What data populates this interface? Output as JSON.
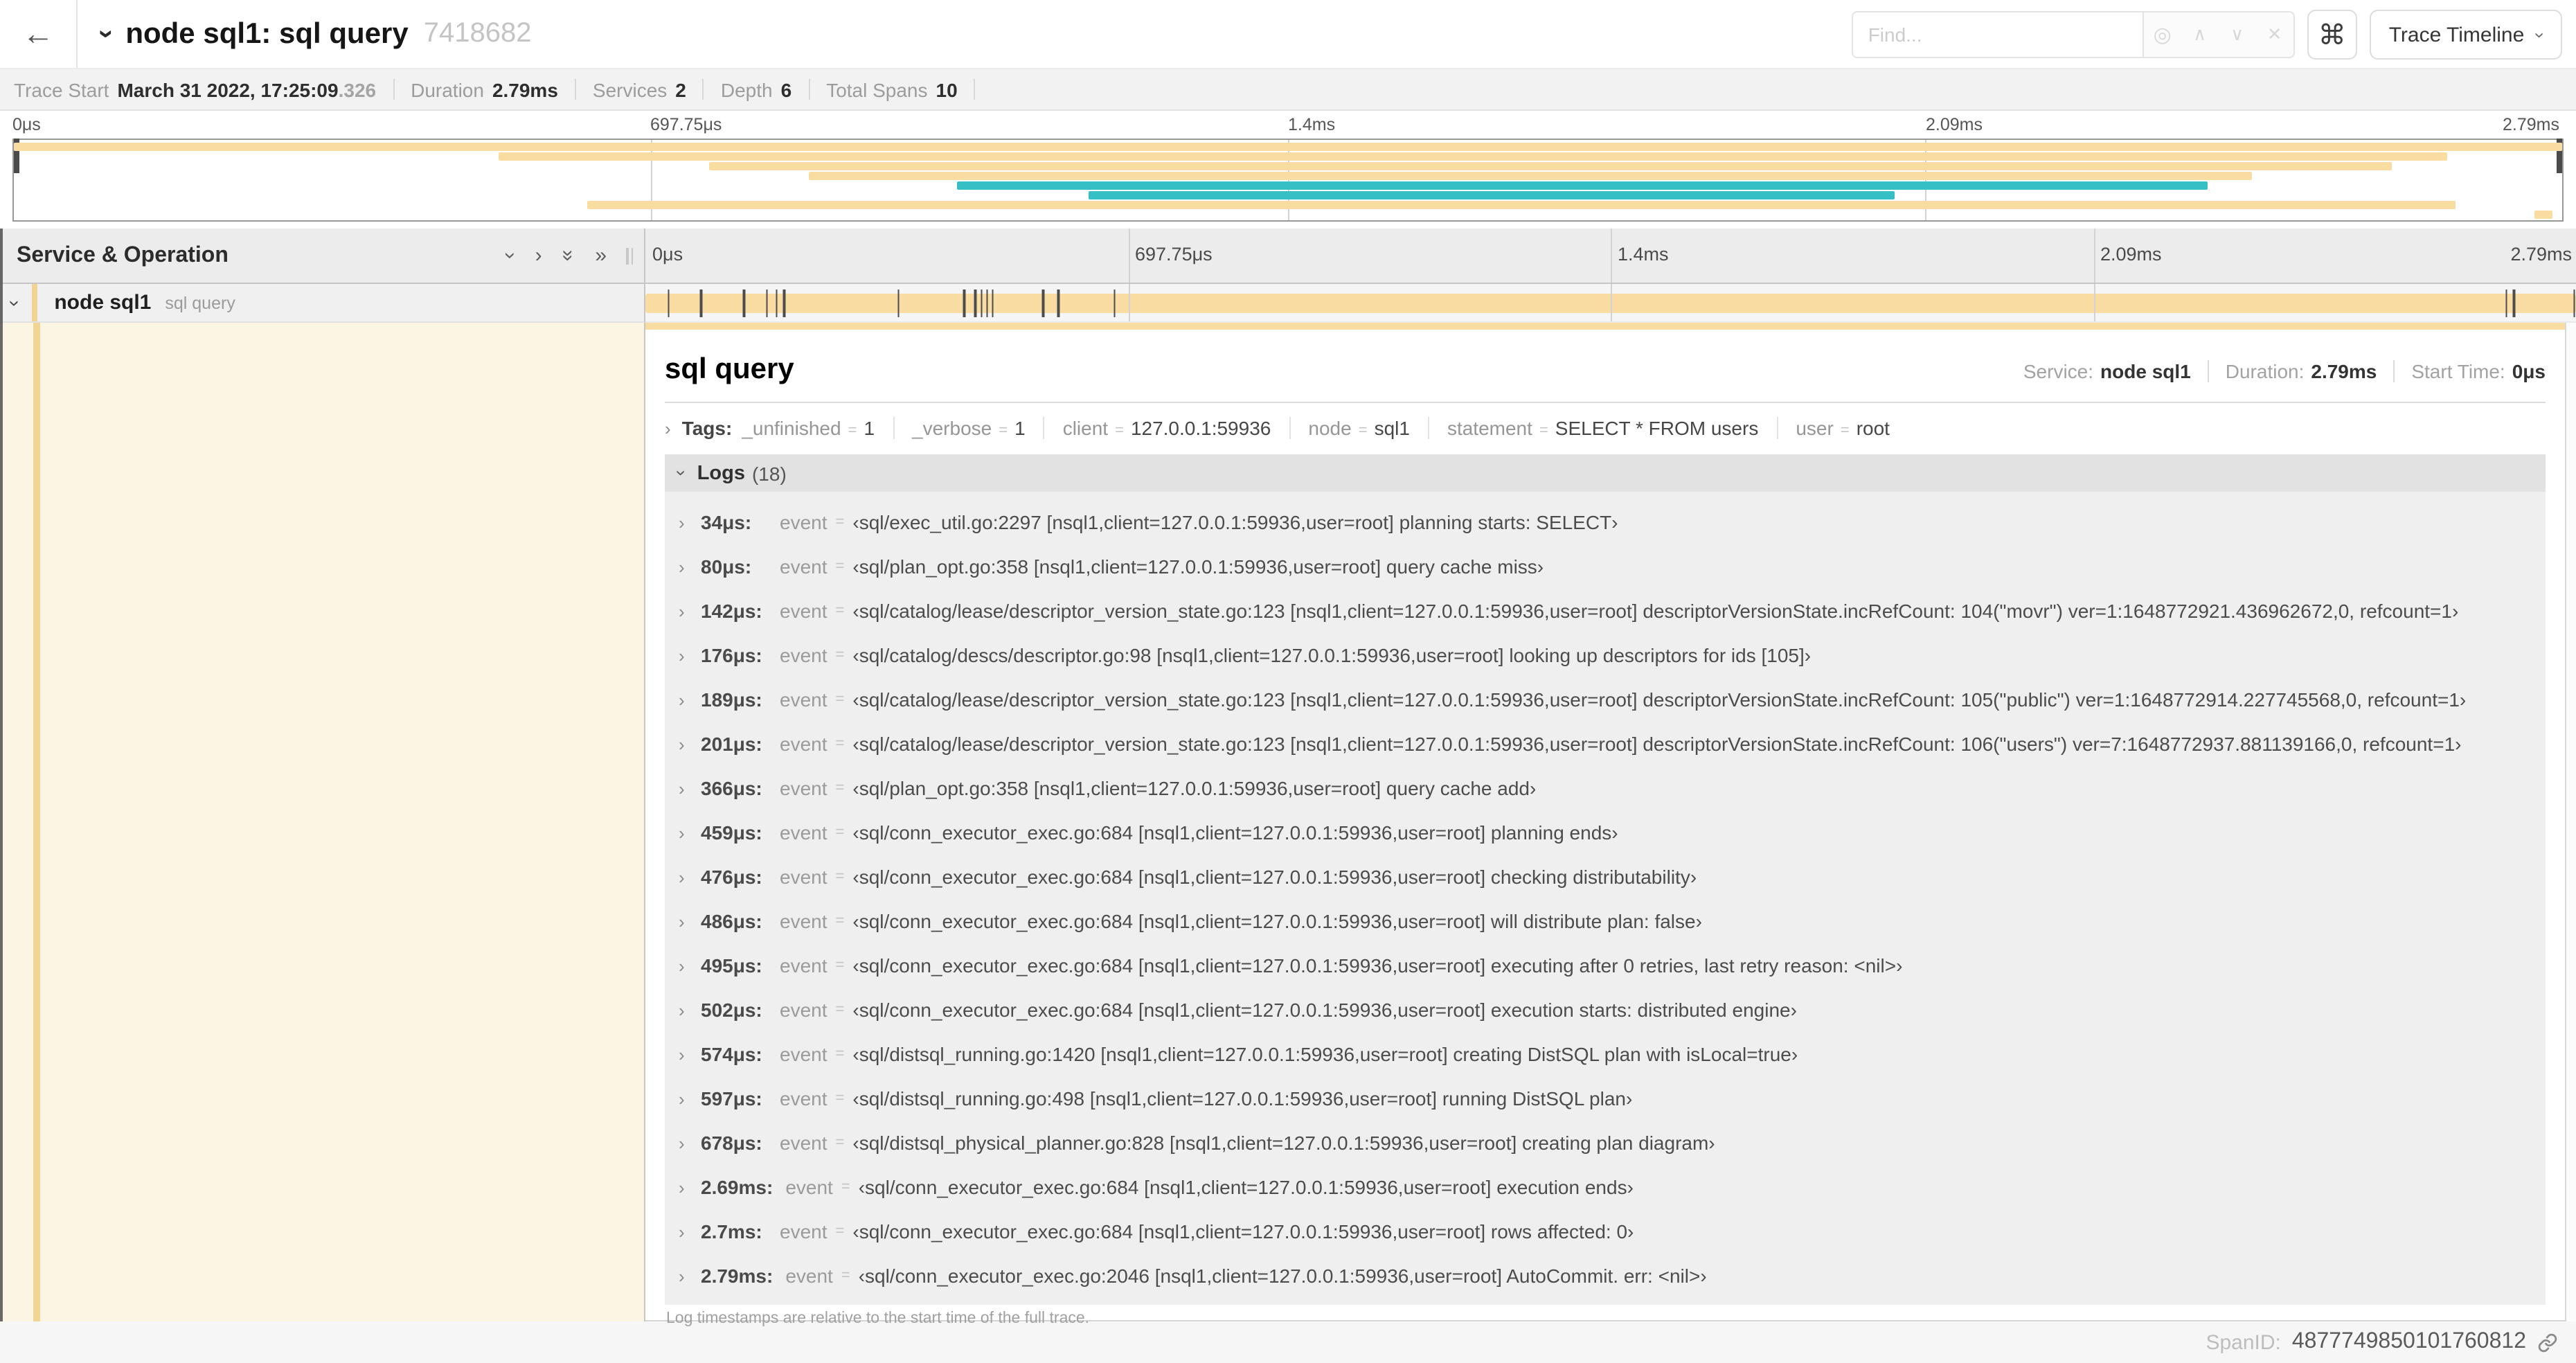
{
  "header": {
    "back_icon": "←",
    "title": "node sql1: sql query",
    "trace_id": "7418682",
    "find_placeholder": "Find...",
    "locate_icon": "◎",
    "prev_icon": "∧",
    "next_icon": "∨",
    "clear_icon": "✕",
    "shortcut_icon": "⌘",
    "view_selector_label": "Trace Timeline"
  },
  "trace_info": {
    "items": [
      {
        "label": "Trace Start",
        "value": "March 31 2022, 17:25:09",
        "suffix": ".326"
      },
      {
        "label": "Duration",
        "value": "2.79ms",
        "suffix": ""
      },
      {
        "label": "Services",
        "value": "2",
        "suffix": ""
      },
      {
        "label": "Depth",
        "value": "6",
        "suffix": ""
      },
      {
        "label": "Total Spans",
        "value": "10",
        "suffix": ""
      }
    ]
  },
  "timeline": {
    "ticks": [
      {
        "label": "0μs",
        "pos": 0
      },
      {
        "label": "697.75μs",
        "pos": 25
      },
      {
        "label": "1.4ms",
        "pos": 50
      },
      {
        "label": "2.09ms",
        "pos": 75
      },
      {
        "label": "2.79ms",
        "pos": 100
      }
    ],
    "grid_positions": [
      25,
      50,
      75
    ],
    "minimap_spans": [
      {
        "row": 0,
        "start": 0,
        "end": 100,
        "color": "#F8DCA1"
      },
      {
        "row": 1,
        "start": 19,
        "end": 95.5,
        "color": "#F8DCA1"
      },
      {
        "row": 2,
        "start": 27.3,
        "end": 93.3,
        "color": "#F8DCA1"
      },
      {
        "row": 3,
        "start": 31.2,
        "end": 87.8,
        "color": "#F8DCA1"
      },
      {
        "row": 4,
        "start": 37,
        "end": 86.1,
        "color": "#36BFC4"
      },
      {
        "row": 5,
        "start": 42.2,
        "end": 73.8,
        "color": "#36BFC4"
      },
      {
        "row": 6,
        "start": 22.5,
        "end": 95.8,
        "color": "#F8DCA1"
      },
      {
        "row": 7,
        "start": 98.9,
        "end": 99.6,
        "color": "#F8DCA1"
      }
    ],
    "log_markers": [
      1.2,
      2.9,
      5.1,
      6.3,
      6.8,
      7.2,
      13.1,
      16.5,
      17.1,
      17.4,
      17.7,
      18.0,
      20.6,
      21.4,
      24.3,
      96.4,
      96.8,
      99.9
    ],
    "span_bar_color": "#F8DCA1"
  },
  "span_table": {
    "header_label": "Service & Operation",
    "rows": [
      {
        "service": "node sql1",
        "operation": "sql query"
      }
    ]
  },
  "detail": {
    "title": "sql query",
    "overview": [
      {
        "label": "Service:",
        "value": "node sql1"
      },
      {
        "label": "Duration:",
        "value": "2.79ms"
      },
      {
        "label": "Start Time:",
        "value": "0μs"
      }
    ],
    "tags": {
      "label": "Tags:",
      "items": [
        {
          "key": "_unfinished",
          "eq": "=",
          "value": "1"
        },
        {
          "key": "_verbose",
          "eq": "=",
          "value": "1"
        },
        {
          "key": "client",
          "eq": "=",
          "value": "127.0.0.1:59936"
        },
        {
          "key": "node",
          "eq": "=",
          "value": "sql1"
        },
        {
          "key": "statement",
          "eq": "=",
          "value": "SELECT * FROM users"
        },
        {
          "key": "user",
          "eq": "=",
          "value": "root"
        }
      ]
    },
    "logs": {
      "label": "Logs",
      "count": "(18)",
      "entries": [
        {
          "time": "34μs:",
          "field": "event",
          "eq": "=",
          "value": "‹sql/exec_util.go:2297 [nsql1,client=127.0.0.1:59936,user=root] planning starts: SELECT›"
        },
        {
          "time": "80μs:",
          "field": "event",
          "eq": "=",
          "value": "‹sql/plan_opt.go:358 [nsql1,client=127.0.0.1:59936,user=root] query cache miss›"
        },
        {
          "time": "142μs:",
          "field": "event",
          "eq": "=",
          "value": "‹sql/catalog/lease/descriptor_version_state.go:123 [nsql1,client=127.0.0.1:59936,user=root] descriptorVersionState.incRefCount: 104(\"movr\") ver=1:1648772921.436962672,0, refcount=1›"
        },
        {
          "time": "176μs:",
          "field": "event",
          "eq": "=",
          "value": "‹sql/catalog/descs/descriptor.go:98 [nsql1,client=127.0.0.1:59936,user=root] looking up descriptors for ids [105]›"
        },
        {
          "time": "189μs:",
          "field": "event",
          "eq": "=",
          "value": "‹sql/catalog/lease/descriptor_version_state.go:123 [nsql1,client=127.0.0.1:59936,user=root] descriptorVersionState.incRefCount: 105(\"public\") ver=1:1648772914.227745568,0, refcount=1›"
        },
        {
          "time": "201μs:",
          "field": "event",
          "eq": "=",
          "value": "‹sql/catalog/lease/descriptor_version_state.go:123 [nsql1,client=127.0.0.1:59936,user=root] descriptorVersionState.incRefCount: 106(\"users\") ver=7:1648772937.881139166,0, refcount=1›"
        },
        {
          "time": "366μs:",
          "field": "event",
          "eq": "=",
          "value": "‹sql/plan_opt.go:358 [nsql1,client=127.0.0.1:59936,user=root] query cache add›"
        },
        {
          "time": "459μs:",
          "field": "event",
          "eq": "=",
          "value": "‹sql/conn_executor_exec.go:684 [nsql1,client=127.0.0.1:59936,user=root] planning ends›"
        },
        {
          "time": "476μs:",
          "field": "event",
          "eq": "=",
          "value": "‹sql/conn_executor_exec.go:684 [nsql1,client=127.0.0.1:59936,user=root] checking distributability›"
        },
        {
          "time": "486μs:",
          "field": "event",
          "eq": "=",
          "value": "‹sql/conn_executor_exec.go:684 [nsql1,client=127.0.0.1:59936,user=root] will distribute plan: false›"
        },
        {
          "time": "495μs:",
          "field": "event",
          "eq": "=",
          "value": "‹sql/conn_executor_exec.go:684 [nsql1,client=127.0.0.1:59936,user=root] executing after 0 retries, last retry reason: <nil>›"
        },
        {
          "time": "502μs:",
          "field": "event",
          "eq": "=",
          "value": "‹sql/conn_executor_exec.go:684 [nsql1,client=127.0.0.1:59936,user=root] execution starts: distributed engine›"
        },
        {
          "time": "574μs:",
          "field": "event",
          "eq": "=",
          "value": "‹sql/distsql_running.go:1420 [nsql1,client=127.0.0.1:59936,user=root] creating DistSQL plan with isLocal=true›"
        },
        {
          "time": "597μs:",
          "field": "event",
          "eq": "=",
          "value": "‹sql/distsql_running.go:498 [nsql1,client=127.0.0.1:59936,user=root] running DistSQL plan›"
        },
        {
          "time": "678μs:",
          "field": "event",
          "eq": "=",
          "value": "‹sql/distsql_physical_planner.go:828 [nsql1,client=127.0.0.1:59936,user=root] creating plan diagram›"
        },
        {
          "time": "2.69ms:",
          "field": "event",
          "eq": "=",
          "value": "‹sql/conn_executor_exec.go:684 [nsql1,client=127.0.0.1:59936,user=root] execution ends›"
        },
        {
          "time": "2.7ms:",
          "field": "event",
          "eq": "=",
          "value": "‹sql/conn_executor_exec.go:684 [nsql1,client=127.0.0.1:59936,user=root] rows affected: 0›"
        },
        {
          "time": "2.79ms:",
          "field": "event",
          "eq": "=",
          "value": "‹sql/conn_executor_exec.go:2046 [nsql1,client=127.0.0.1:59936,user=root] AutoCommit. err: <nil>›"
        }
      ],
      "footnote": "Log timestamps are relative to the start time of the full trace."
    },
    "span_id_label": "SpanID:",
    "span_id": "4877749850101760812"
  },
  "colors": {
    "span_tan": "#F8DCA1",
    "span_teal": "#36BFC4",
    "detail_left_bg": "#FDF5E3",
    "accent_stripe": "#F2D394"
  }
}
